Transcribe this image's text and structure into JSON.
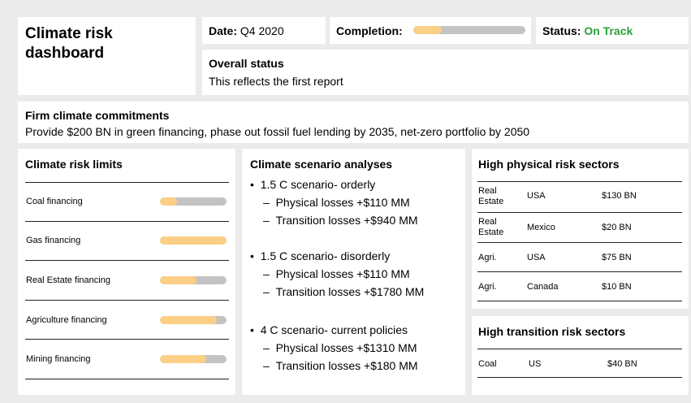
{
  "title": "Climate risk dashboard",
  "date": {
    "label": "Date:",
    "value": "Q4 2020"
  },
  "completion": {
    "label": "Completion:",
    "progress": 0.25
  },
  "status": {
    "label": "Status:",
    "value": "On Track",
    "color": "#2aa13a"
  },
  "overall": {
    "heading": "Overall status",
    "text": "This reflects the first report"
  },
  "commitments": {
    "heading": "Firm climate commitments",
    "text": "Provide $200 BN in green financing, phase out fossil fuel lending by 2035, net-zero portfolio by 2050"
  },
  "limits": {
    "heading": "Climate risk limits",
    "items": [
      {
        "label": "Coal financing",
        "progress": 0.25
      },
      {
        "label": "Gas financing",
        "progress": 1.0
      },
      {
        "label": "Real Estate financing",
        "progress": 0.55
      },
      {
        "label": "Agriculture financing",
        "progress": 0.85
      },
      {
        "label": "Mining financing",
        "progress": 0.7
      }
    ]
  },
  "scenarios": {
    "heading": "Climate scenario analyses",
    "items": [
      {
        "bullet": "•",
        "title": "1.5 C scenario- orderly",
        "subs": [
          "Physical losses +$110 MM",
          "Transition losses +$940 MM"
        ]
      },
      {
        "bullet": "•",
        "title": "1.5 C scenario- disorderly",
        "subs": [
          "Physical losses +$110 MM",
          "Transition losses +$1780 MM"
        ]
      },
      {
        "bullet": "•",
        "title": "4 C scenario- current policies",
        "subs": [
          "Physical losses +$1310 MM",
          "Transition losses +$180 MM"
        ]
      }
    ],
    "dash": "–"
  },
  "physical": {
    "heading": "High physical risk sectors",
    "rows": [
      {
        "sector": "Real\nEstate",
        "country": "USA",
        "value": "$130 BN"
      },
      {
        "sector": "Real\nEstate",
        "country": "Mexico",
        "value": "$20 BN"
      },
      {
        "sector": "Agri.",
        "country": "USA",
        "value": "$75 BN"
      },
      {
        "sector": "Agri.",
        "country": "Canada",
        "value": "$10 BN"
      }
    ]
  },
  "transition": {
    "heading": "High transition risk sectors",
    "rows": [
      {
        "sector": "Coal",
        "country": "US",
        "value": "$40 BN"
      }
    ]
  }
}
